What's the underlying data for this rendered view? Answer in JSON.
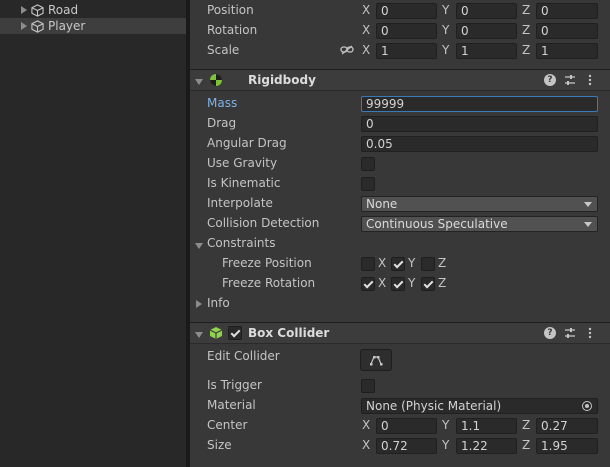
{
  "hierarchy": {
    "items": [
      {
        "label": "Road"
      },
      {
        "label": "Player"
      }
    ]
  },
  "transform": {
    "position": {
      "label": "Position",
      "x": "0",
      "y": "0",
      "z": "0"
    },
    "rotation": {
      "label": "Rotation",
      "x": "0",
      "y": "0",
      "z": "0"
    },
    "scale": {
      "label": "Scale",
      "x": "1",
      "y": "1",
      "z": "1"
    }
  },
  "axes": {
    "x": "X",
    "y": "Y",
    "z": "Z"
  },
  "rigidbody": {
    "title": "Rigidbody",
    "mass": {
      "label": "Mass",
      "value": "99999"
    },
    "drag": {
      "label": "Drag",
      "value": "0"
    },
    "angular_drag": {
      "label": "Angular Drag",
      "value": "0.05"
    },
    "use_gravity": {
      "label": "Use Gravity",
      "checked": false
    },
    "is_kinematic": {
      "label": "Is Kinematic",
      "checked": false
    },
    "interpolate": {
      "label": "Interpolate",
      "value": "None"
    },
    "collision_detection": {
      "label": "Collision Detection",
      "value": "Continuous Speculative"
    },
    "constraints": {
      "label": "Constraints",
      "freeze_position": {
        "label": "Freeze Position",
        "x": false,
        "y": true,
        "z": false
      },
      "freeze_rotation": {
        "label": "Freeze Rotation",
        "x": true,
        "y": true,
        "z": true
      }
    },
    "info": {
      "label": "Info"
    }
  },
  "box_collider": {
    "title": "Box Collider",
    "enabled": true,
    "edit_collider": {
      "label": "Edit Collider"
    },
    "is_trigger": {
      "label": "Is Trigger",
      "checked": false
    },
    "material": {
      "label": "Material",
      "value": "None (Physic Material)"
    },
    "center": {
      "label": "Center",
      "x": "0",
      "y": "1.1",
      "z": "0.27"
    },
    "size": {
      "label": "Size",
      "x": "0.72",
      "y": "1.22",
      "z": "1.95"
    }
  },
  "colors": {
    "accent": "#3a79bb",
    "mass_label": "#7fb2e6",
    "rigidbody_icon": "#7ec23a",
    "collider_icon": "#8fd14f"
  },
  "icons": [
    "cube-icon",
    "rigidbody-icon",
    "box-collider-icon",
    "help-icon",
    "preset-icon",
    "more-icon",
    "link-icon",
    "edit-collider-icon",
    "object-picker-icon"
  ]
}
